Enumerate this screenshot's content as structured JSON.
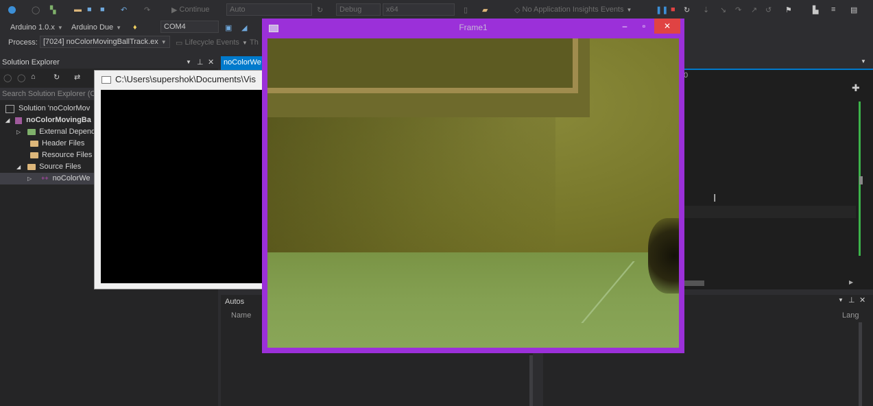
{
  "toolbar": {
    "continue_label": "Continue",
    "autos_label": "Auto",
    "debug_label": "Debug",
    "platform_label": "x64",
    "insights_label": "No Application Insights Events",
    "board_version": "Arduino 1.0.x",
    "board_name": "Arduino Due",
    "port": "COM4",
    "process_label": "Process:",
    "process_value": "[7024] noColorMovingBallTrack.ex",
    "lifecycle_label": "Lifecycle Events",
    "thread_label": "Th"
  },
  "explorer": {
    "title": "Solution Explorer",
    "search_placeholder": "Search Solution Explorer (C",
    "items": [
      {
        "label": "Solution 'noColorMov"
      },
      {
        "label": "noColorMovingBa"
      },
      {
        "label": "External Depend"
      },
      {
        "label": "Header Files"
      },
      {
        "label": "Resource Files"
      },
      {
        "label": "Source Files"
      },
      {
        "label": "noColorWe"
      }
    ]
  },
  "editor": {
    "tab_label": "noColorWe",
    "zoom_tail": "0"
  },
  "autos": {
    "title": "Autos",
    "col_name": "Name",
    "col_lang": "Lang"
  },
  "console": {
    "title": "C:\\Users\\supershok\\Documents\\Vis"
  },
  "frame": {
    "title": "Frame1"
  },
  "colors": {
    "accent": "#007acc",
    "frame_border": "#9b30d9",
    "close_red": "#e04343"
  }
}
